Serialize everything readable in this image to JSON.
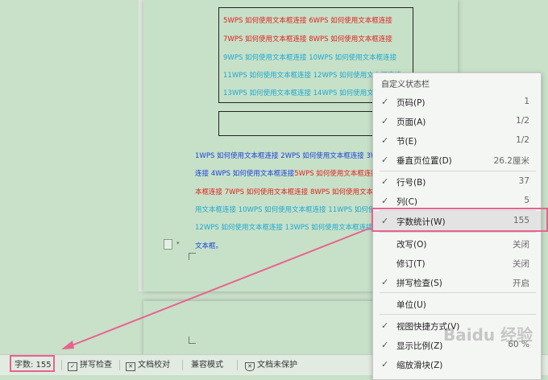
{
  "table_box": {
    "lines": [
      {
        "text": "5WPS 如何使用文本框连接 6WPS 如何使用文本框连接",
        "color": "#e0201e"
      },
      {
        "text": "7WPS 如何使用文本框连接 8WPS 如何使用文本框连接",
        "color": "#e0201e"
      },
      {
        "text": "9WPS 如何使用文本框连接 10WPS 如何使用文本框连接",
        "color": "#1fa6cf"
      },
      {
        "text": "11WPS 如何使用文本框连接 12WPS 如何使用文本框连接",
        "color": "#1fa6cf"
      },
      {
        "text": "13WPS 如何使用文本框连接 14WPS 如何使用文本框连接",
        "color": "#1fa6cf"
      }
    ]
  },
  "paragraph": {
    "lines": [
      {
        "text": "1WPS 如何使用文本框连接 2WPS 如何使用文本框连接 3WPS",
        "color": "#1a3fd8"
      },
      {
        "text": "连接 4WPS 如何使用文本框连接",
        "color": "#1a3fd8",
        "text2": "5WPS 如何使用文本框连接",
        "color2": "#e0201e"
      },
      {
        "text": "本框连接 7WPS 如何使用文本框连接 8WPS 如何使用文本框",
        "color": "#e0201e"
      },
      {
        "text": "用文本框连接 10WPS 如何使用文本框连接 11WPS 如何使",
        "color": "#1fa6cf"
      },
      {
        "text": "12WPS 如何使用文本框连接 13WPS 如何使用文本框连接",
        "color": "#1fa6cf"
      },
      {
        "text": "文本框。",
        "color": "#1a3fd8"
      }
    ]
  },
  "statusbar": {
    "word_count": "字数: 155",
    "spell_check": "拼写检查",
    "doc_proof": "文档校对",
    "compat_mode": "兼容模式",
    "doc_protect": "文档未保护"
  },
  "menu": {
    "title": "自定义状态栏",
    "items": [
      {
        "label": "页码(P)",
        "value": "1",
        "checked": true
      },
      {
        "label": "页面(A)",
        "value": "1/2",
        "checked": true
      },
      {
        "label": "节(E)",
        "value": "1/2",
        "checked": true
      },
      {
        "label": "垂直页位置(D)",
        "value": "26.2厘米",
        "checked": true
      },
      {
        "label": "行号(B)",
        "value": "37",
        "checked": true
      },
      {
        "label": "列(C)",
        "value": "5",
        "checked": true
      },
      {
        "label": "字数统计(W)",
        "value": "155",
        "checked": true
      },
      {
        "label": "改写(O)",
        "value": "关闭",
        "checked": false
      },
      {
        "label": "修订(T)",
        "value": "关闭",
        "checked": false
      },
      {
        "label": "拼写检查(S)",
        "value": "开启",
        "checked": true
      },
      {
        "label": "单位(U)",
        "value": "",
        "checked": false
      },
      {
        "label": "视图快捷方式(V)",
        "value": "",
        "checked": true
      },
      {
        "label": "显示比例(Z)",
        "value": "60 %",
        "checked": true
      },
      {
        "label": "缩放滑块(Z)",
        "value": "",
        "checked": true
      }
    ]
  },
  "watermark": "Baidu 经验",
  "colors": {
    "highlight": "#e8628f"
  }
}
